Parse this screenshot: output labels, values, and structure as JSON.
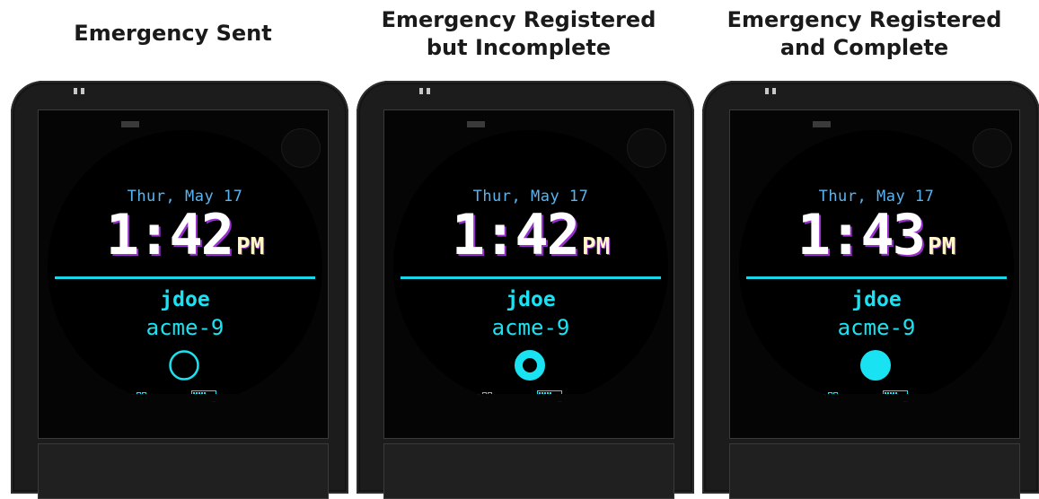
{
  "colors": {
    "accent_cyan": "#19e3f2",
    "date_blue": "#5ab4f0",
    "time_white": "#ffffff",
    "time_shadow_purple": "#9a2fd0",
    "ampm_cream": "#fff7c8",
    "device_body": "#1c1c1c",
    "screen_bg": "#050505"
  },
  "panels": [
    {
      "caption": [
        "Emergency Sent"
      ],
      "date": "Thur, May 17",
      "time": "1:42",
      "ampm": "PM",
      "user": "jdoe",
      "org": "acme-9",
      "status_icon": "hollow-ring-icon",
      "signal_bars_lit": 3,
      "signal_icon": "signal-strength-icon",
      "battery_icon": "battery-icon"
    },
    {
      "caption": [
        "Emergency Registered",
        "but Incomplete"
      ],
      "date": "Thur, May 17",
      "time": "1:42",
      "ampm": "PM",
      "user": "jdoe",
      "org": "acme-9",
      "status_icon": "thick-ring-icon",
      "signal_bars_lit": 3,
      "signal_icon": "signal-strength-icon",
      "battery_icon": "battery-icon"
    },
    {
      "caption": [
        "Emergency Registered",
        "and Complete"
      ],
      "date": "Thur, May 17",
      "time": "1:43",
      "ampm": "PM",
      "user": "jdoe",
      "org": "acme-9",
      "status_icon": "filled-circle-icon",
      "signal_bars_lit": 3,
      "signal_icon": "signal-strength-icon",
      "battery_icon": "battery-icon"
    }
  ]
}
